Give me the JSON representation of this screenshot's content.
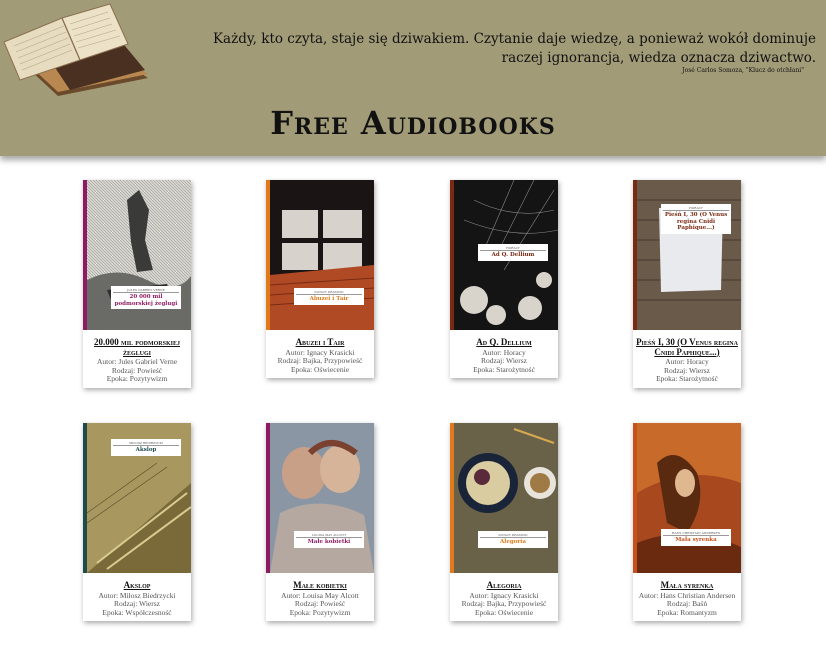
{
  "header": {
    "quote": "Każdy, kto czyta, staje się dziwakiem. Czytanie daje wiedzę, a ponieważ wokół dominuje raczej ignorancja, wiedza oznacza dziwactwo.",
    "quote_source": "José Carlos Somoza, \"Klucz do otchłani\"",
    "site_title": "Free Audiobooks"
  },
  "books": [
    {
      "title": "20.000 mil podmorskiej żeglugi",
      "cover_author": "JULES GABRIEL VERNE",
      "cover_title": "20 000 mil podmorskiej żeglugi",
      "author": "Autor: Jules Gabriel Verne",
      "kind": "Rodzaj: Powieść",
      "epoch": "Epoka: Pozytywizm",
      "spine": "#8e1a62",
      "title_color": "#8e1a62"
    },
    {
      "title": "Abuzei i Tair",
      "cover_author": "IGNACY KRASICKI",
      "cover_title": "Abuzei i Tair",
      "author": "Autor: Ignacy Krasicki",
      "kind": "Rodzaj: Bajka, Przypowieść",
      "epoch": "Epoka: Oświecenie",
      "spine": "#e07a1a",
      "title_color": "#e07a1a"
    },
    {
      "title": "Ad Q. Dellium",
      "cover_author": "HORACY",
      "cover_title": "Ad Q. Dellium",
      "author": "Autor: Horacy",
      "kind": "Rodzaj: Wiersz",
      "epoch": "Epoka: Starożytność",
      "spine": "#7a2a12",
      "title_color": "#7a2a12"
    },
    {
      "title": "Pieśń I, 30 (O Venus regina Cnidi Paphique...)",
      "cover_author": "HORACY",
      "cover_title": "Pieśń I, 30 (O Venus regina Cnidi Paphique...)",
      "author": "Autor: Horacy",
      "kind": "Rodzaj: Wiersz",
      "epoch": "Epoka: Starożytność",
      "spine": "#7a2a12",
      "title_color": "#7a2a12"
    },
    {
      "title": "Akslop",
      "cover_author": "MIŁOSZ BIEDRZYCKI",
      "cover_title": "Akslop",
      "author": "Autor: Miłosz Biedrzycki",
      "kind": "Rodzaj: Wiersz",
      "epoch": "Epoka: Współczesność",
      "spine": "#1f4a4a",
      "title_color": "#1f4a4a"
    },
    {
      "title": "Małe kobietki",
      "cover_author": "LOUISA MAY ALCOTT",
      "cover_title": "Małe kobietki",
      "author": "Autor: Louisa May Alcott",
      "kind": "Rodzaj: Powieść",
      "epoch": "Epoka: Pozytywizm",
      "spine": "#8e1a62",
      "title_color": "#8e1a62"
    },
    {
      "title": "Alegoria",
      "cover_author": "IGNACY KRASICKI",
      "cover_title": "Alegoria",
      "author": "Autor: Ignacy Krasicki",
      "kind": "Rodzaj: Bajka, Przypowieść",
      "epoch": "Epoka: Oświecenie",
      "spine": "#e07a1a",
      "title_color": "#e07a1a"
    },
    {
      "title": "Mała syrenka",
      "cover_author": "HANS CHRISTIAN ANDERSEN",
      "cover_title": "Mała syrenka",
      "author": "Autor: Hans Christian Andersen",
      "kind": "Rodzaj: Baśń",
      "epoch": "Epoka: Romantyzm",
      "spine": "#c8501a",
      "title_color": "#c8501a"
    }
  ]
}
